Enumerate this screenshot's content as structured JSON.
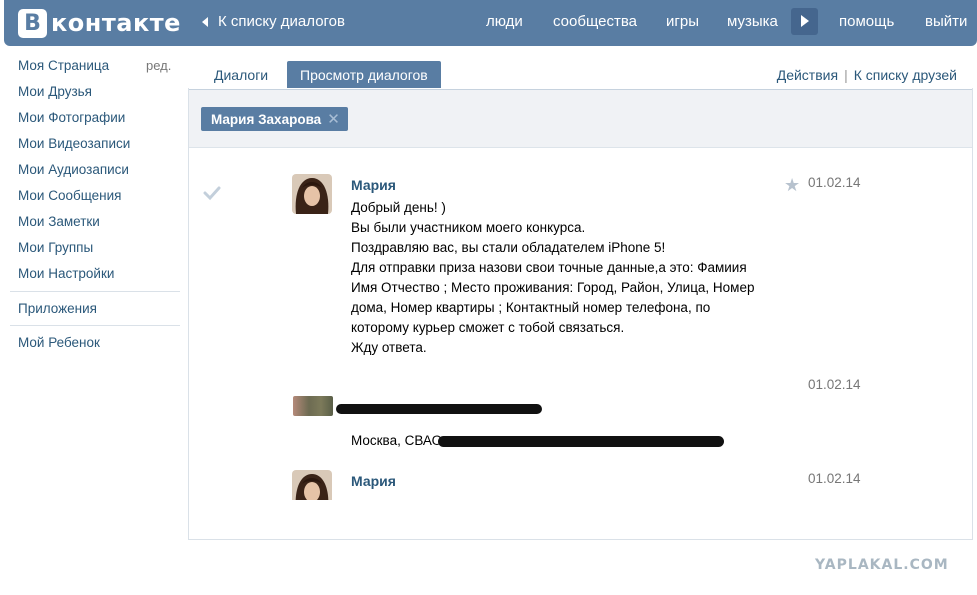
{
  "header": {
    "logo_letter": "В",
    "logo_text": "контакте",
    "back_link": "К списку диалогов",
    "nav": [
      "люди",
      "сообщества",
      "игры",
      "музыка",
      "помощь",
      "выйти"
    ]
  },
  "sidebar": {
    "items": [
      "Моя Страница",
      "Мои Друзья",
      "Мои Фотографии",
      "Мои Видеозаписи",
      "Мои Аудиозаписи",
      "Мои Сообщения",
      "Мои Заметки",
      "Мои Группы",
      "Мои Настройки"
    ],
    "edit_label": "ред.",
    "apps": "Приложения",
    "child": "Мой Ребенок"
  },
  "main": {
    "tabs": [
      "Диалоги",
      "Просмотр диалогов"
    ],
    "actions": "Действия",
    "actions_sep": "|",
    "friends_link": "К списку друзей",
    "filter_chip": "Мария Захарова",
    "chip_close": "✕"
  },
  "messages": [
    {
      "author": "Мария",
      "date": "01.02.14",
      "lines": [
        "Добрый день! )",
        "Вы были участником моего конкурса.",
        "Поздравляю вас, вы стали обладателем iPhone 5!",
        "Для отправки приза назови свои точные данные,а это: Фамиия",
        "Имя Отчество ; Место проживания: Город, Район, Улица, Номер",
        "дома, Номер квартиры ; Контактный номер телефона, по",
        "которому курьер сможет с тобой связаться.",
        "Жду ответа."
      ]
    },
    {
      "date": "01.02.14",
      "city_prefix": "Москва, СВАО"
    },
    {
      "author": "Мария",
      "date": "01.02.14"
    }
  ],
  "watermark": "YAPLAKAL.COM"
}
